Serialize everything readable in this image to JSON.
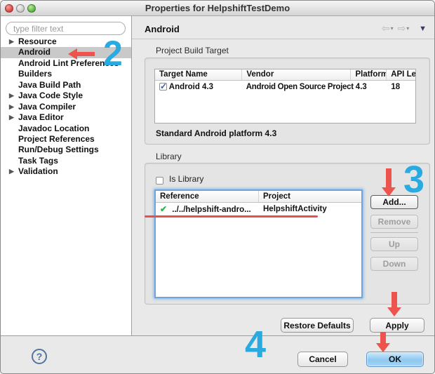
{
  "window": {
    "title": "Properties for HelpshiftTestDemo"
  },
  "sidebar": {
    "filter_placeholder": "type filter text",
    "items": [
      {
        "label": "Resource",
        "expandable": true,
        "selected": false
      },
      {
        "label": "Android",
        "expandable": false,
        "selected": true
      },
      {
        "label": "Android Lint Preferences",
        "expandable": false,
        "selected": false
      },
      {
        "label": "Builders",
        "expandable": false,
        "selected": false
      },
      {
        "label": "Java Build Path",
        "expandable": false,
        "selected": false
      },
      {
        "label": "Java Code Style",
        "expandable": true,
        "selected": false
      },
      {
        "label": "Java Compiler",
        "expandable": true,
        "selected": false
      },
      {
        "label": "Java Editor",
        "expandable": true,
        "selected": false
      },
      {
        "label": "Javadoc Location",
        "expandable": false,
        "selected": false
      },
      {
        "label": "Project References",
        "expandable": false,
        "selected": false
      },
      {
        "label": "Run/Debug Settings",
        "expandable": false,
        "selected": false
      },
      {
        "label": "Task Tags",
        "expandable": false,
        "selected": false
      },
      {
        "label": "Validation",
        "expandable": true,
        "selected": false
      }
    ]
  },
  "panel": {
    "title": "Android",
    "nav": {
      "back": "⇦",
      "back_dd": "▾",
      "forward": "⇨",
      "forward_dd": "▾",
      "view_menu": "▼"
    }
  },
  "build_target": {
    "label": "Project Build Target",
    "columns": [
      "Target Name",
      "Vendor",
      "Platform",
      "API Le"
    ],
    "row": {
      "checked": true,
      "name": "Android 4.3",
      "vendor": "Android Open Source Project",
      "platform": "4.3",
      "api_level": "18"
    },
    "summary": "Standard Android platform 4.3"
  },
  "library": {
    "label": "Library",
    "is_library": "Is Library",
    "is_library_checked": false,
    "columns": [
      "Reference",
      "Project"
    ],
    "row": {
      "reference": "../../helpshift-andro...",
      "project": "HelpshiftActivity"
    },
    "buttons": {
      "add": "Add...",
      "remove": "Remove",
      "up": "Up",
      "down": "Down"
    }
  },
  "actions": {
    "restore": "Restore Defaults",
    "apply": "Apply"
  },
  "footer": {
    "help": "?",
    "cancel": "Cancel",
    "ok": "OK"
  },
  "annotations": {
    "step2": "2",
    "step3": "3",
    "step4": "4",
    "blue": "#29abe2",
    "red": "#ed544d",
    "underline_red": "#e05252",
    "success_green": "#2fb34a",
    "focus_ring_blue": "#6ca6dc"
  }
}
